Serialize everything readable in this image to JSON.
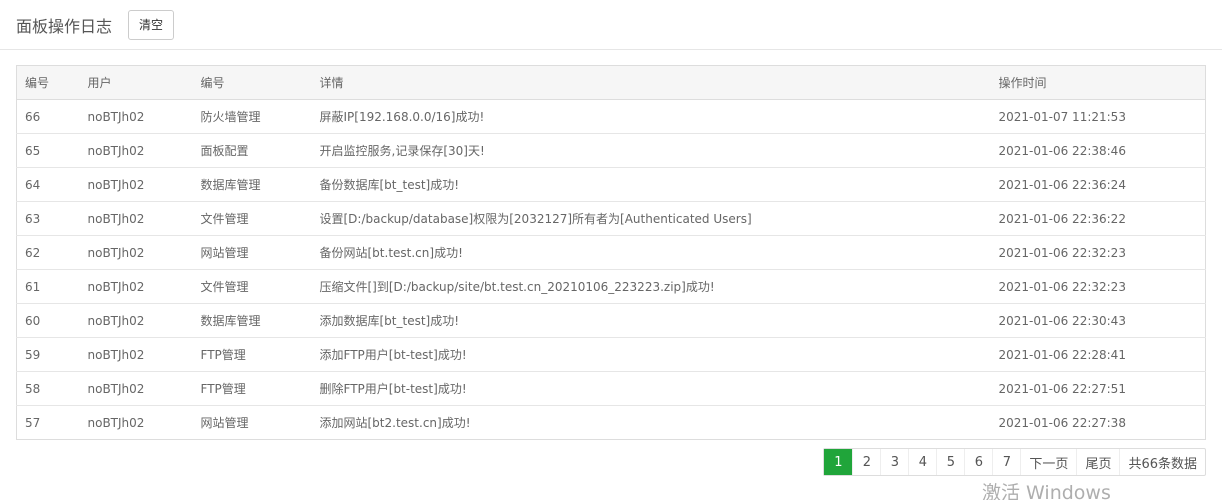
{
  "header": {
    "title": "面板操作日志",
    "clear_label": "清空"
  },
  "table": {
    "columns": [
      "编号",
      "用户",
      "编号",
      "详情",
      "操作时间"
    ],
    "rows": [
      {
        "id": "66",
        "user": "noBTJh02",
        "type": "防火墙管理",
        "detail": "屏蔽IP[192.168.0.0/16]成功!",
        "time": "2021-01-07 11:21:53"
      },
      {
        "id": "65",
        "user": "noBTJh02",
        "type": "面板配置",
        "detail": "开启监控服务,记录保存[30]天!",
        "time": "2021-01-06 22:38:46"
      },
      {
        "id": "64",
        "user": "noBTJh02",
        "type": "数据库管理",
        "detail": "备份数据库[bt_test]成功!",
        "time": "2021-01-06 22:36:24"
      },
      {
        "id": "63",
        "user": "noBTJh02",
        "type": "文件管理",
        "detail": "设置[D:/backup/database]权限为[2032127]所有者为[Authenticated Users]",
        "time": "2021-01-06 22:36:22"
      },
      {
        "id": "62",
        "user": "noBTJh02",
        "type": "网站管理",
        "detail": "备份网站[bt.test.cn]成功!",
        "time": "2021-01-06 22:32:23"
      },
      {
        "id": "61",
        "user": "noBTJh02",
        "type": "文件管理",
        "detail": "压缩文件[]到[D:/backup/site/bt.test.cn_20210106_223223.zip]成功!",
        "time": "2021-01-06 22:32:23"
      },
      {
        "id": "60",
        "user": "noBTJh02",
        "type": "数据库管理",
        "detail": "添加数据库[bt_test]成功!",
        "time": "2021-01-06 22:30:43"
      },
      {
        "id": "59",
        "user": "noBTJh02",
        "type": "FTP管理",
        "detail": "添加FTP用户[bt-test]成功!",
        "time": "2021-01-06 22:28:41"
      },
      {
        "id": "58",
        "user": "noBTJh02",
        "type": "FTP管理",
        "detail": "删除FTP用户[bt-test]成功!",
        "time": "2021-01-06 22:27:51"
      },
      {
        "id": "57",
        "user": "noBTJh02",
        "type": "网站管理",
        "detail": "添加网站[bt2.test.cn]成功!",
        "time": "2021-01-06 22:27:38"
      }
    ]
  },
  "pagination": {
    "pages": [
      "1",
      "2",
      "3",
      "4",
      "5",
      "6",
      "7"
    ],
    "current": "1",
    "next_label": "下一页",
    "last_label": "尾页",
    "total_label": "共66条数据"
  },
  "watermark": "激活 Windows",
  "colors": {
    "accent": "#20a53a"
  }
}
